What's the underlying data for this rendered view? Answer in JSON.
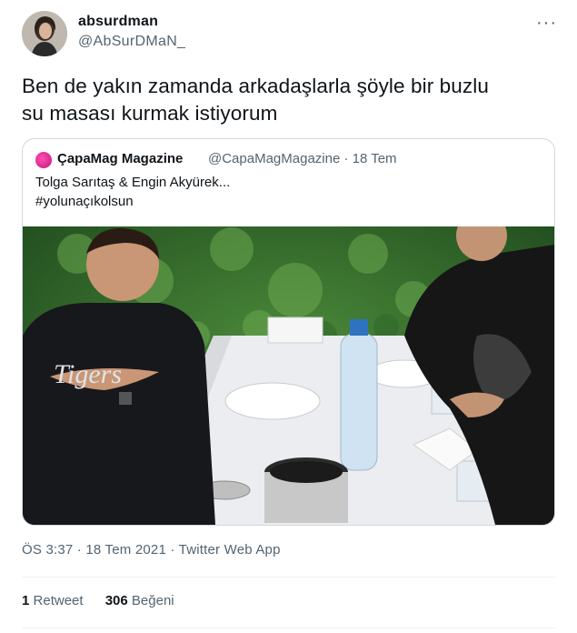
{
  "author": {
    "name": "absurdman",
    "handle": "@AbSurDMaN_",
    "more_label": "···"
  },
  "tweet": {
    "line1": "Ben de yakın zamanda arkadaşlarla şöyle bir buzlu",
    "line2": "su masası kurmak istiyorum"
  },
  "quote": {
    "name": "ÇapaMag Magazine",
    "handle_time": "@CapaMagMagazine · 18 Tem",
    "line1": "Tolga Sarıtaş & Engin Akyürek...",
    "line2": "#yolunaçıkolsun",
    "photo_text": "Tigers"
  },
  "meta": {
    "time_date_source": "ÖS 3:37 · 18 Tem 2021 · Twitter Web App"
  },
  "stats": {
    "retweet_count": "1",
    "retweet_label": "Retweet",
    "like_count": "306",
    "like_label": "Beğeni"
  }
}
